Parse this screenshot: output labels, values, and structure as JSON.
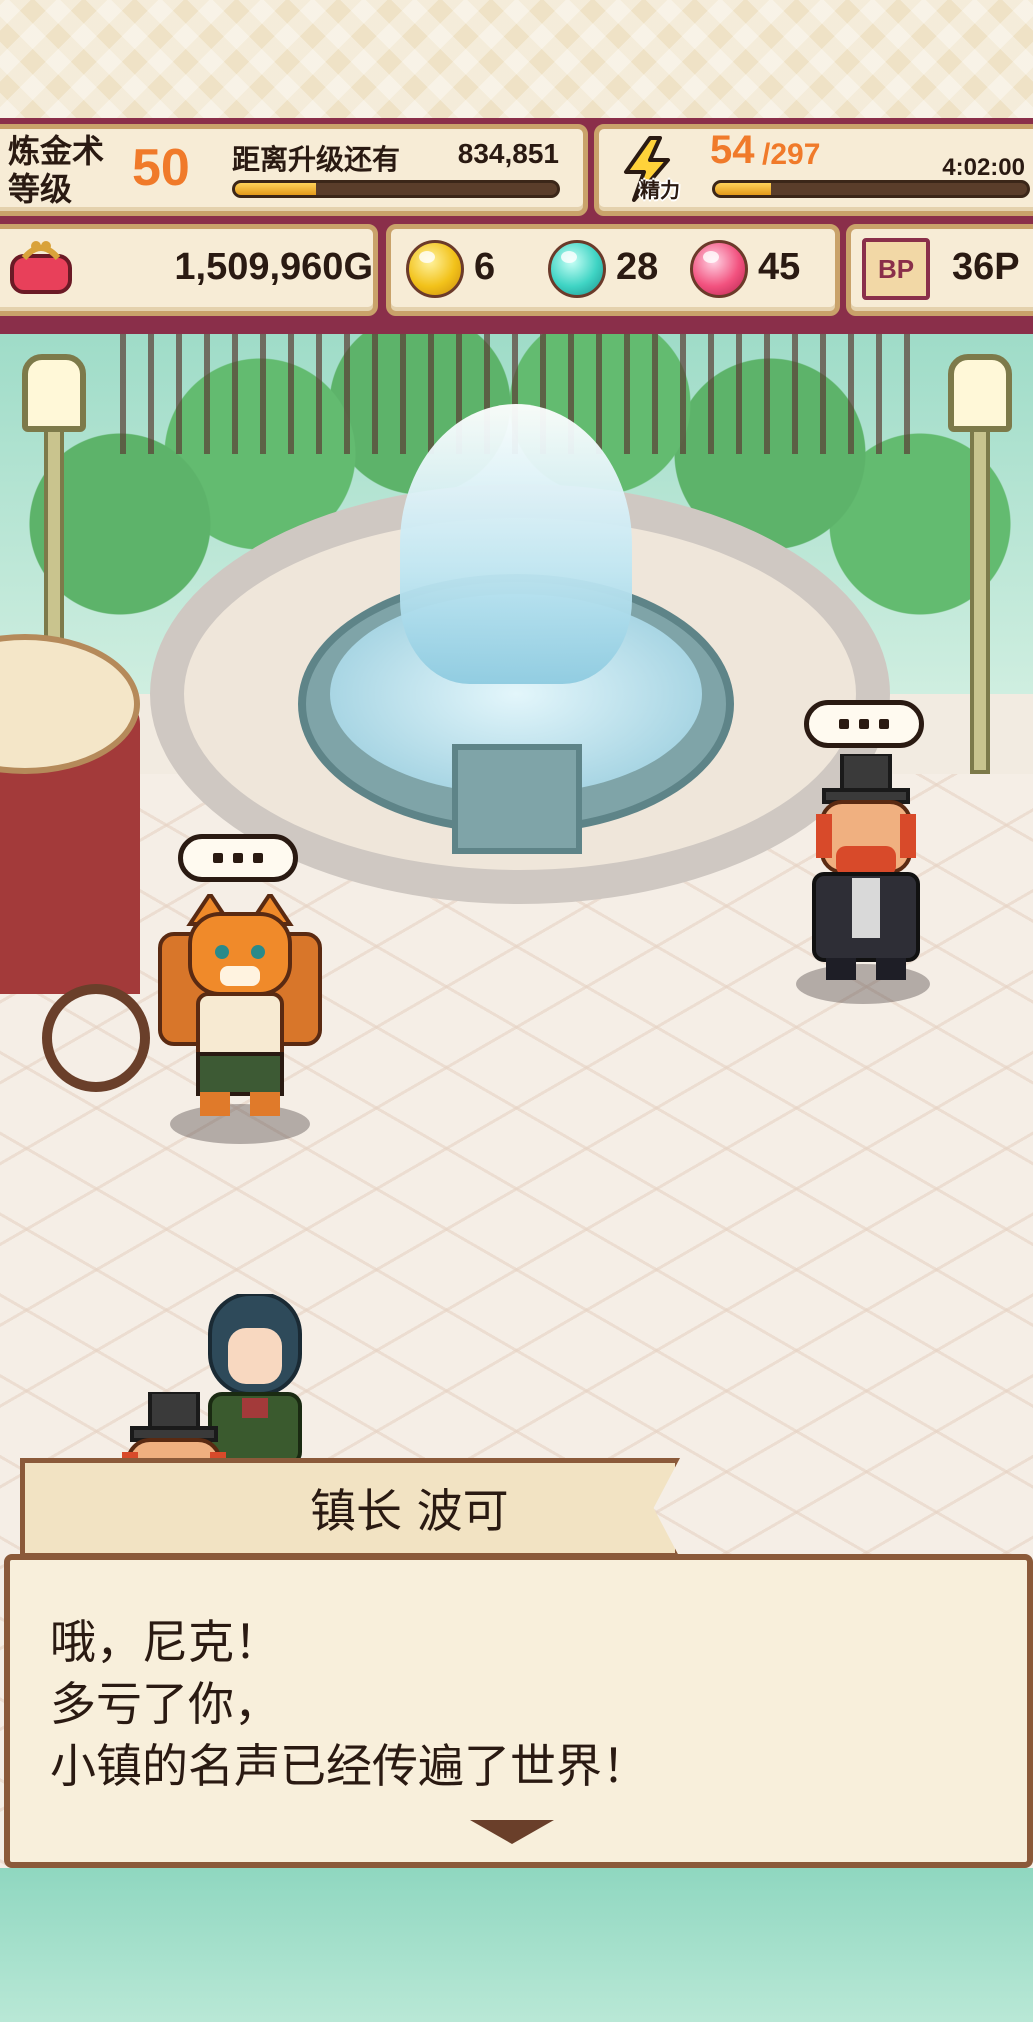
{
  "hud": {
    "level_label": "炼金术\n等级",
    "level_value": "50",
    "xp_label": "距离升级还有",
    "xp_remaining": "834,851",
    "xp_progress": 0.25,
    "energy_label": "精力",
    "energy_current": "54",
    "energy_max": "/297",
    "energy_progress": 0.18,
    "energy_timer": "4:02:00",
    "gold": "1,509,960G",
    "gems": {
      "yellow": "6",
      "teal": "28",
      "pink": "45"
    },
    "bp_label": "BP",
    "bp_value": "36P",
    "colors": {
      "frame": "#8a2f4a",
      "accent": "#f07a2a",
      "bar_fill": "#e39a1b"
    }
  },
  "scene": {
    "icons": [
      "purse-icon",
      "bolt-icon",
      "gem-yellow-icon",
      "gem-teal-icon",
      "gem-pink-icon",
      "bp-icon"
    ]
  },
  "dialogue": {
    "speaker": "镇长 波可",
    "lines": [
      "哦，尼克！",
      "多亏了你，",
      "小镇的名声已经传遍了世界！"
    ]
  }
}
